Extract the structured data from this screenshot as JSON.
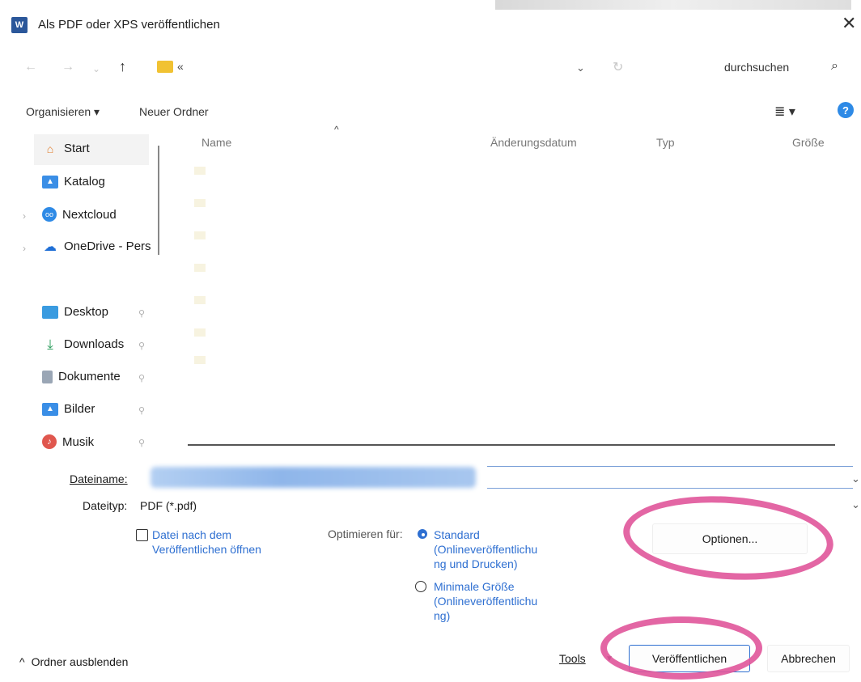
{
  "window": {
    "title": "Als PDF oder XPS veröffentlichen",
    "app_icon_letter": "W",
    "close_glyph": "✕"
  },
  "nav": {
    "back": "←",
    "forward": "→",
    "dropdown": "⌄",
    "up": "↑",
    "breadcrumb": "«",
    "address_dropdown": "⌄",
    "refresh": "↻",
    "search_text": "durchsuchen",
    "search_glyph": "⌕"
  },
  "toolbar": {
    "organize": "Organisieren ▾",
    "new_folder": "Neuer Ordner",
    "view_glyph": "≣ ▾",
    "help_glyph": "?"
  },
  "sidebar": {
    "items": [
      {
        "label": "Start",
        "icon": "home-icon"
      },
      {
        "label": "Katalog",
        "icon": "gallery-icon"
      },
      {
        "label": "Nextcloud",
        "icon": "nextcloud-icon"
      },
      {
        "label": "OneDrive - Pers",
        "icon": "onedrive-icon"
      },
      {
        "label": "Desktop",
        "icon": "desktop-icon"
      },
      {
        "label": "Downloads",
        "icon": "download-icon"
      },
      {
        "label": "Dokumente",
        "icon": "document-icon"
      },
      {
        "label": "Bilder",
        "icon": "pictures-icon"
      },
      {
        "label": "Musik",
        "icon": "music-icon"
      }
    ]
  },
  "columns": {
    "name": "Name",
    "modified": "Änderungsdatum",
    "type": "Typ",
    "size": "Größe"
  },
  "form": {
    "filename_label": "Dateiname:",
    "filetype_label": "Dateityp:",
    "filetype_value": "PDF (*.pdf)",
    "open_after_line1": "Datei nach dem",
    "open_after_line2": "Veröffentlichen öffnen",
    "optimize_label": "Optimieren für:",
    "standard_line1": "Standard",
    "standard_line2": "(Onlineveröffentlichu",
    "standard_line3": "ng und Drucken)",
    "minimal_line1": "Minimale Größe",
    "minimal_line2": "(Onlineveröffentlichu",
    "minimal_line3": "ng)",
    "options_button": "Optionen..."
  },
  "footer": {
    "hide_folders": "Ordner ausblenden",
    "tools": "Tools",
    "publish": "Veröffentlichen",
    "cancel": "Abbrechen"
  },
  "colors": {
    "accent": "#2e6fd1",
    "annotation": "#e0559a"
  }
}
